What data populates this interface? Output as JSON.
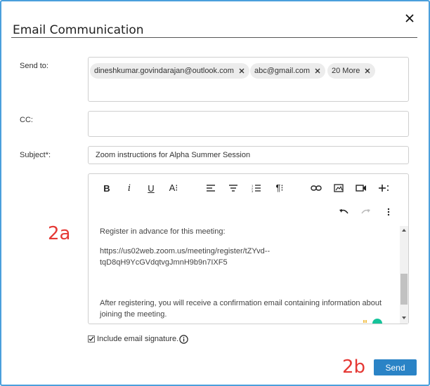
{
  "dialog": {
    "title": "Email Communication"
  },
  "send_to": {
    "label": "Send to:",
    "recipients": [
      "dineshkumar.govindarajan@outlook.com",
      "abc@gmail.com",
      "20 More"
    ]
  },
  "cc": {
    "label": "CC:",
    "value": ""
  },
  "subject": {
    "label": "Subject*:",
    "value": "Zoom instructions for Alpha Summer Session"
  },
  "editor": {
    "toolbar": {
      "bold": "B",
      "italic": "i",
      "underline": "U",
      "font_size": "A⁝",
      "paragraph": "¶⁝"
    },
    "body_lines": [
      "Register in advance for this meeting:",
      "https://us02web.zoom.us/meeting/register/tZYvd--",
      "tqD8qH9YcGVdqtvgJmnH9b9n7IXF5",
      "After registering, you will receive a confirmation email containing information about",
      "joining the meeting."
    ]
  },
  "signature": {
    "label": "Include email signature.",
    "checked": true
  },
  "annotations": {
    "a": "2a",
    "b": "2b"
  },
  "actions": {
    "send_label": "Send"
  },
  "colors": {
    "accent": "#2a83c6",
    "frame_border": "#4a9fdc",
    "annotation": "#e53935"
  }
}
